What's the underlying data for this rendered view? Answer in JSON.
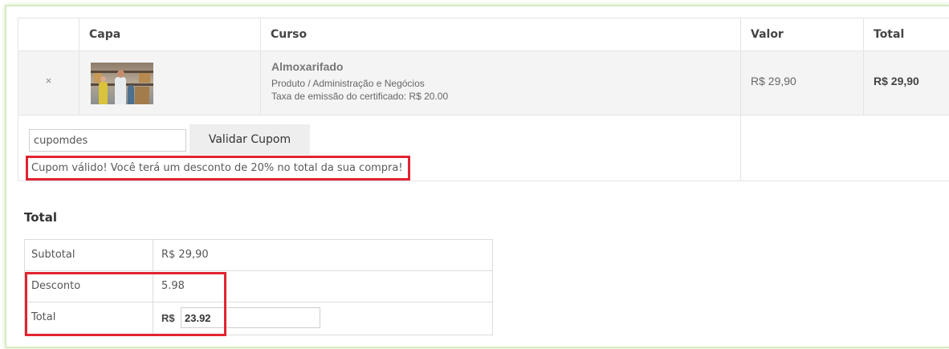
{
  "cart": {
    "headers": {
      "remove": "",
      "cover": "Capa",
      "course": "Curso",
      "price": "Valor",
      "total": "Total"
    },
    "item": {
      "remove_label": "×",
      "name": "Almoxarifado",
      "category": "Produto / Administração e Negócios",
      "fee": "Taxa de emissão do certificado: R$ 20.00",
      "price": "R$ 29,90",
      "total": "R$ 29,90"
    },
    "coupon": {
      "value": "cupomdes",
      "button_label": "Validar Cupom",
      "message": "Cupom válido! Você terá um desconto de 20% no total da sua compra!"
    }
  },
  "totals": {
    "title": "Total",
    "rows": [
      {
        "label": "Subtotal",
        "value": "R$ 29,90"
      },
      {
        "label": "Desconto",
        "value": "5.98"
      },
      {
        "label": "Total",
        "prefix": "R$",
        "value": "23.92"
      }
    ]
  },
  "colors": {
    "highlight": "#e22431",
    "frame_glow": "#d6ecbf"
  }
}
